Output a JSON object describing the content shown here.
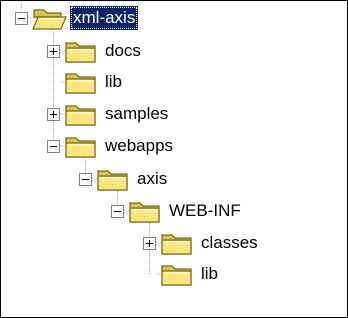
{
  "colors": {
    "selection_bg": "#0a246a",
    "selection_text": "#ffffff",
    "folder_fill": "#f8e67c",
    "folder_outline": "#7a6a1a",
    "tree_line": "#a0a0a0"
  },
  "tree": {
    "nodes": [
      {
        "label": "xml-axis",
        "icon": "folder-open-icon",
        "expander": "minus",
        "selected": true
      },
      {
        "label": "docs",
        "icon": "folder-icon",
        "expander": "plus",
        "selected": false
      },
      {
        "label": "lib",
        "icon": "folder-icon",
        "expander": "none",
        "selected": false
      },
      {
        "label": "samples",
        "icon": "folder-icon",
        "expander": "plus",
        "selected": false
      },
      {
        "label": "webapps",
        "icon": "folder-icon",
        "expander": "minus",
        "selected": false
      },
      {
        "label": "axis",
        "icon": "folder-icon",
        "expander": "minus",
        "selected": false
      },
      {
        "label": "WEB-INF",
        "icon": "folder-icon",
        "expander": "minus",
        "selected": false
      },
      {
        "label": "classes",
        "icon": "folder-icon",
        "expander": "plus",
        "selected": false
      },
      {
        "label": "lib",
        "icon": "folder-icon",
        "expander": "none",
        "selected": false
      }
    ]
  }
}
